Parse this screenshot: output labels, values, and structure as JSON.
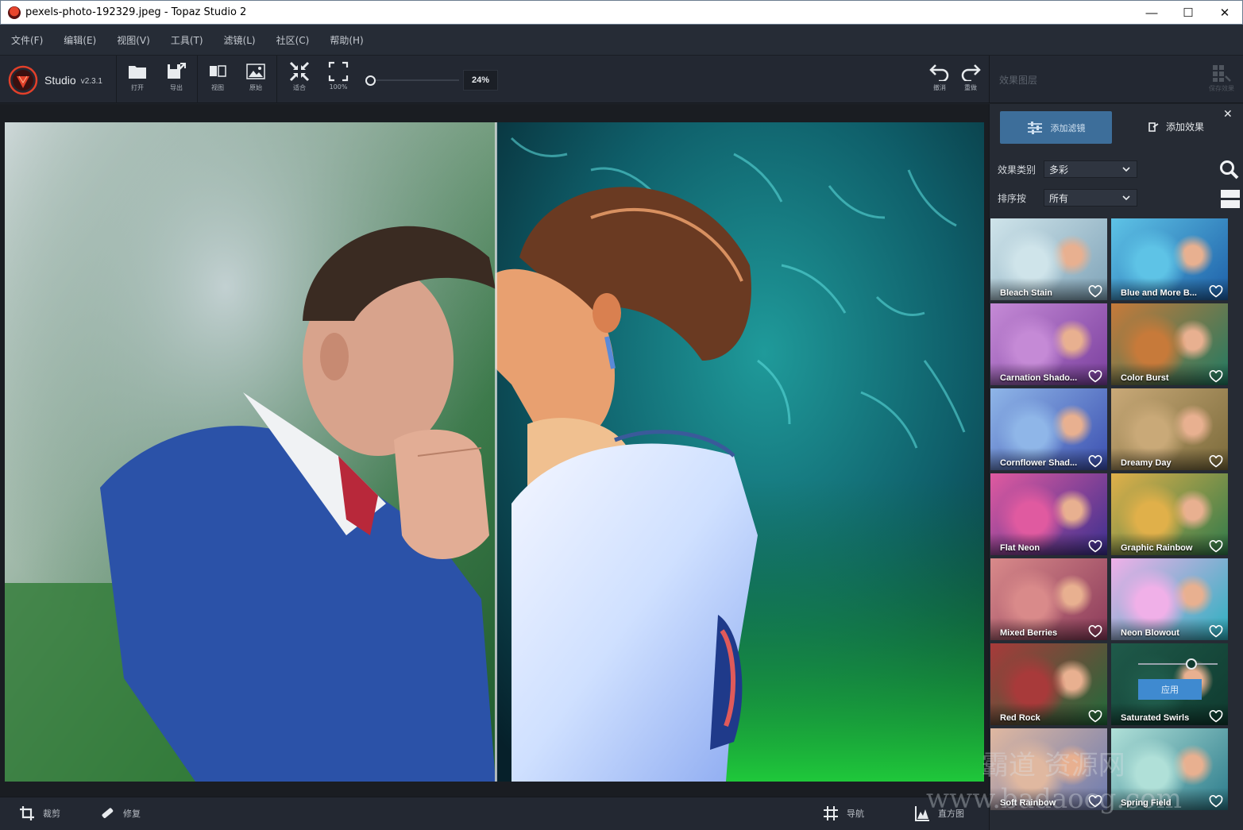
{
  "window": {
    "title": "pexels-photo-192329.jpeg - Topaz Studio 2",
    "minimize": "—",
    "maximize": "☐",
    "close": "✕"
  },
  "menu": [
    "文件(F)",
    "编辑(E)",
    "视图(V)",
    "工具(T)",
    "滤镜(L)",
    "社区(C)",
    "帮助(H)"
  ],
  "brand": {
    "name": "Studio",
    "version": "v2.3.1"
  },
  "toolbar": {
    "open": "打开",
    "export": "导出",
    "view": "视图",
    "original": "原始",
    "fit": "适合",
    "zoom100_icon_text": "100%",
    "zoom100": "100%",
    "zoom_value": "24%",
    "zoom_level": 0.0,
    "undo": "撤消",
    "redo": "重做"
  },
  "right_header": {
    "title": "效果图层",
    "save": "保存效果"
  },
  "right_panel": {
    "add_filter": "添加滤镜",
    "add_effect": "添加效果",
    "category_label": "效果类别",
    "category_value": "多彩",
    "sort_label": "排序按",
    "sort_value": "所有",
    "apply_label": "应用"
  },
  "effects": [
    {
      "name": "Bleach Stain",
      "tint": "#7fa3b8",
      "tint2": "#cfe4ea"
    },
    {
      "name": "Blue and More B...",
      "tint": "#1d5fa8",
      "tint2": "#5ec3e6"
    },
    {
      "name": "Carnation Shado...",
      "tint": "#7a3f9e",
      "tint2": "#c58ad6"
    },
    {
      "name": "Color Burst",
      "tint": "#1f7a62",
      "tint2": "#c77a3a"
    },
    {
      "name": "Cornflower Shad...",
      "tint": "#3b4fb0",
      "tint2": "#8fb6e8"
    },
    {
      "name": "Dreamy Day",
      "tint": "#7a6a3a",
      "tint2": "#c9a978"
    },
    {
      "name": "Flat Neon",
      "tint": "#3a2f8f",
      "tint2": "#e05aa0"
    },
    {
      "name": "Graphic Rainbow",
      "tint": "#2f7a4a",
      "tint2": "#e0b04a"
    },
    {
      "name": "Mixed Berries",
      "tint": "#8a3a5a",
      "tint2": "#d98a8a"
    },
    {
      "name": "Neon Blowout",
      "tint": "#2ab0c0",
      "tint2": "#f0b0e8"
    },
    {
      "name": "Red Rock",
      "tint": "#1f6a3a",
      "tint2": "#a83a3a"
    },
    {
      "name": "Saturated Swirls",
      "tint": "#0f3a2f",
      "tint2": "#1f5a4a"
    },
    {
      "name": "Soft Rainbow",
      "tint": "#6a7ab0",
      "tint2": "#e0b8a0"
    },
    {
      "name": "Spring Field",
      "tint": "#2a7a8a",
      "tint2": "#b0e0d8"
    }
  ],
  "bottom": {
    "crop": "裁剪",
    "repair": "修复",
    "nav": "导航",
    "histogram": "直方图"
  },
  "watermark": {
    "line1": "霸道  资源网",
    "line2": "www.badaocg.com"
  },
  "colors": {
    "accent": "#3d6e9a",
    "selected_outline": "#4f9fe0",
    "panel_bg": "#262b34"
  }
}
